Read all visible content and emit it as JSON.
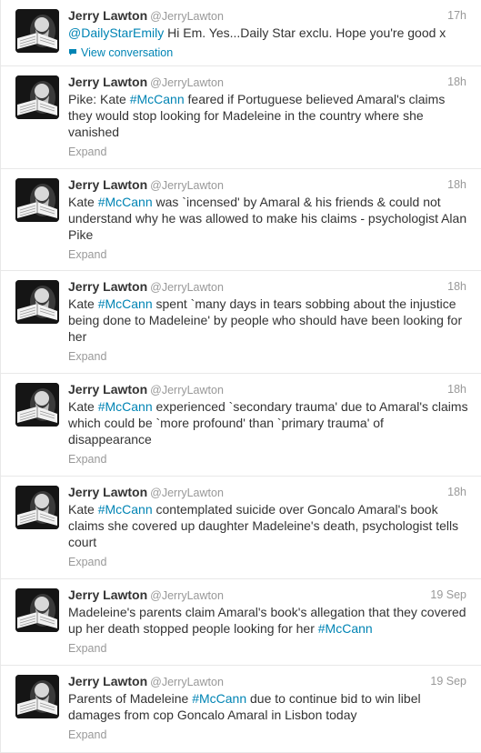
{
  "tweets": [
    {
      "name": "Jerry Lawton",
      "handle": "@JerryLawton",
      "time": "17h",
      "parts": [
        [
          "link",
          "@DailyStarEmily"
        ],
        [
          "text",
          " Hi Em. Yes...Daily Star exclu. Hope you're good x"
        ]
      ],
      "footer_type": "conversation",
      "footer": "View conversation",
      "height": 73
    },
    {
      "name": "Jerry Lawton",
      "handle": "@JerryLawton",
      "time": "18h",
      "parts": [
        [
          "text",
          "Pike: Kate "
        ],
        [
          "link",
          "#McCann"
        ],
        [
          "text",
          " feared if Portuguese believed Amaral's claims they would stop looking for Madeleine in the country where she vanished"
        ]
      ],
      "footer_type": "expand",
      "footer": "Expand",
      "height": 113
    },
    {
      "name": "Jerry Lawton",
      "handle": "@JerryLawton",
      "time": "18h",
      "parts": [
        [
          "text",
          "Kate "
        ],
        [
          "link",
          "#McCann"
        ],
        [
          "text",
          " was `incensed' by Amaral & his friends & could not understand why he was allowed to make his claims - psychologist Alan Pike"
        ]
      ],
      "footer_type": "expand",
      "footer": "Expand",
      "height": 112
    },
    {
      "name": "Jerry Lawton",
      "handle": "@JerryLawton",
      "time": "18h",
      "parts": [
        [
          "text",
          "Kate "
        ],
        [
          "link",
          "#McCann"
        ],
        [
          "text",
          " spent `many days in tears sobbing about the injustice being done to Madeleine' by people who should have been looking for her"
        ]
      ],
      "footer_type": "expand",
      "footer": "Expand",
      "height": 113
    },
    {
      "name": "Jerry Lawton",
      "handle": "@JerryLawton",
      "time": "18h",
      "parts": [
        [
          "text",
          "Kate "
        ],
        [
          "link",
          "#McCann"
        ],
        [
          "text",
          " experienced `secondary trauma' due to Amaral's claims which could be `more profound' than `primary trauma' of disappearance"
        ]
      ],
      "footer_type": "expand",
      "footer": "Expand",
      "height": 113
    },
    {
      "name": "Jerry Lawton",
      "handle": "@JerryLawton",
      "time": "18h",
      "parts": [
        [
          "text",
          "Kate "
        ],
        [
          "link",
          "#McCann"
        ],
        [
          "text",
          " contemplated suicide over Goncalo Amaral's book claims she covered up daughter Madeleine's death, psychologist tells court"
        ]
      ],
      "footer_type": "expand",
      "footer": "Expand",
      "height": 113
    },
    {
      "name": "Jerry Lawton",
      "handle": "@JerryLawton",
      "time": "19 Sep",
      "parts": [
        [
          "text",
          "Madeleine's parents claim Amaral's book's allegation that they covered up her death stopped people looking for her "
        ],
        [
          "link",
          "#McCann"
        ]
      ],
      "footer_type": "expand",
      "footer": "Expand",
      "height": 95
    },
    {
      "name": "Jerry Lawton",
      "handle": "@JerryLawton",
      "time": "19 Sep",
      "parts": [
        [
          "text",
          "Parents of Madeleine "
        ],
        [
          "link",
          "#McCann"
        ],
        [
          "text",
          " due to continue bid to win libel damages from cop Goncalo Amaral in Lisbon today"
        ]
      ],
      "footer_type": "expand",
      "footer": "Expand",
      "height": 96
    }
  ]
}
